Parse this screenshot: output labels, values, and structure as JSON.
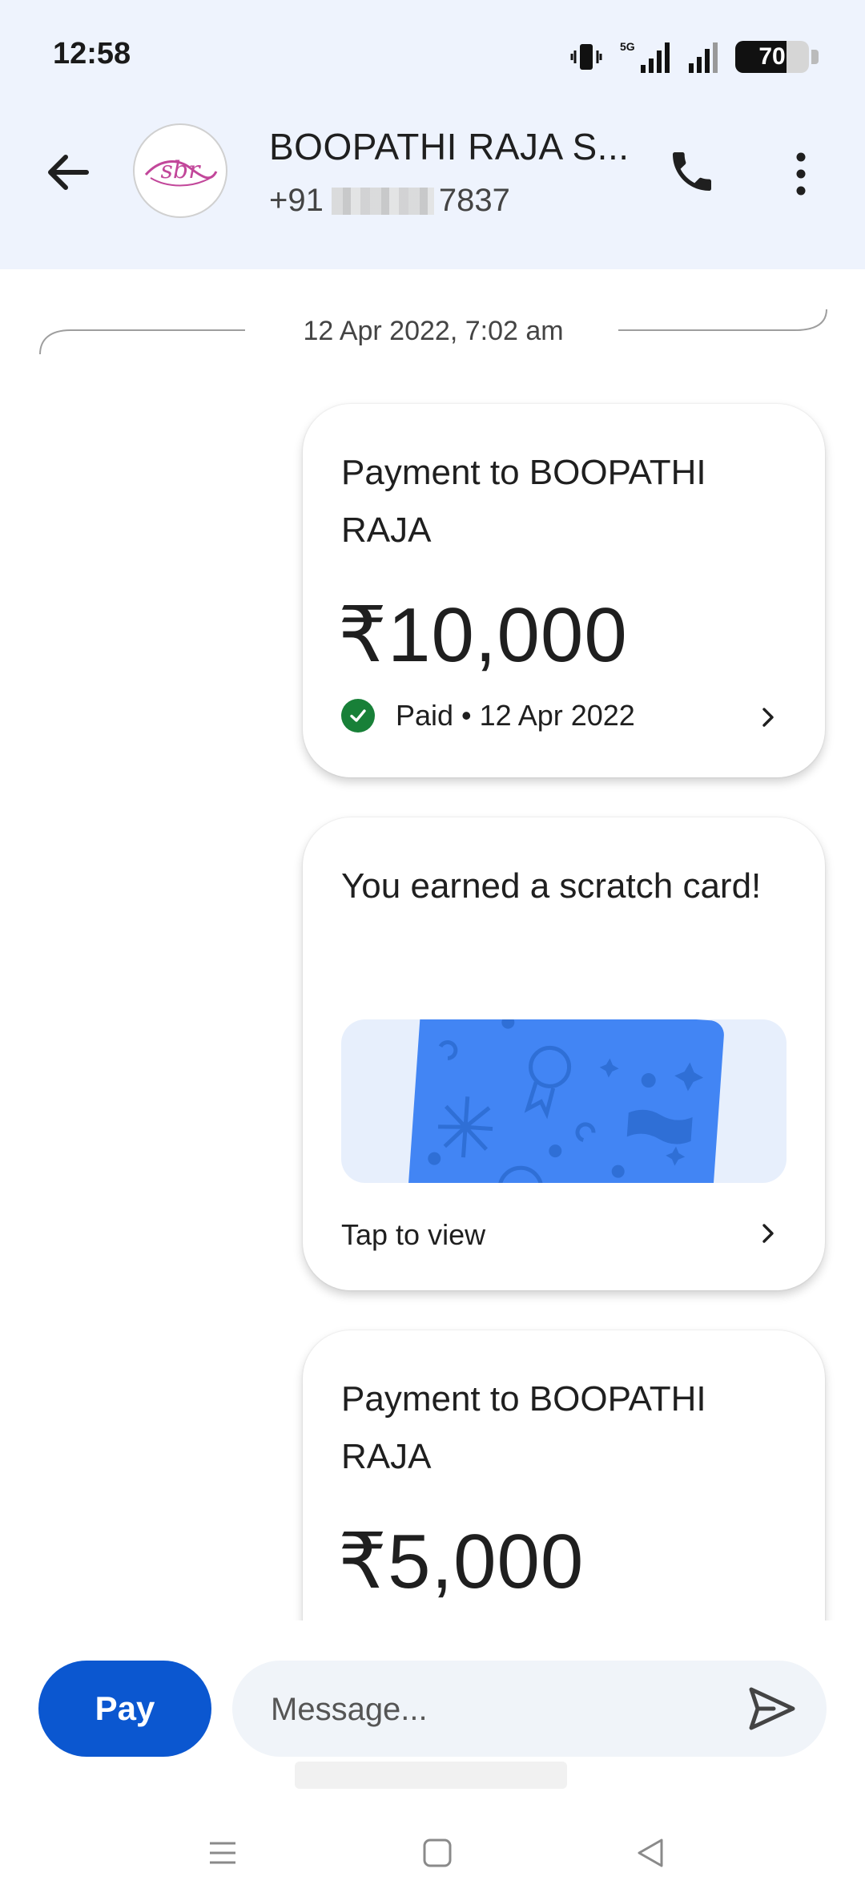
{
  "status_bar": {
    "time": "12:58",
    "network": "5G",
    "battery_level": "70",
    "battery_fraction": 0.7
  },
  "header": {
    "contact_name": "BOOPATHI RAJA S...",
    "phone_prefix": "+91",
    "phone_suffix": "7837",
    "avatar_initials": "sbr",
    "icons": [
      "back-arrow-icon",
      "phone-icon",
      "more-vert-icon"
    ]
  },
  "chat": {
    "date_divider": "12 Apr 2022, 7:02 am",
    "cards": [
      {
        "title": "Payment to BOOPATHI RAJA",
        "amount": "₹10,000",
        "status": "Paid • 12 Apr 2022"
      },
      {
        "title": "You earned a scratch card!",
        "action": "Tap to view"
      },
      {
        "title": "Payment to BOOPATHI RAJA",
        "amount": "₹5,000"
      }
    ]
  },
  "composer": {
    "pay_label": "Pay",
    "message_placeholder": "Message..."
  },
  "colors": {
    "accent": "#0b57d0",
    "header_bg": "#eef3fd",
    "success": "#188038",
    "scratch_card": "#4285f4"
  }
}
